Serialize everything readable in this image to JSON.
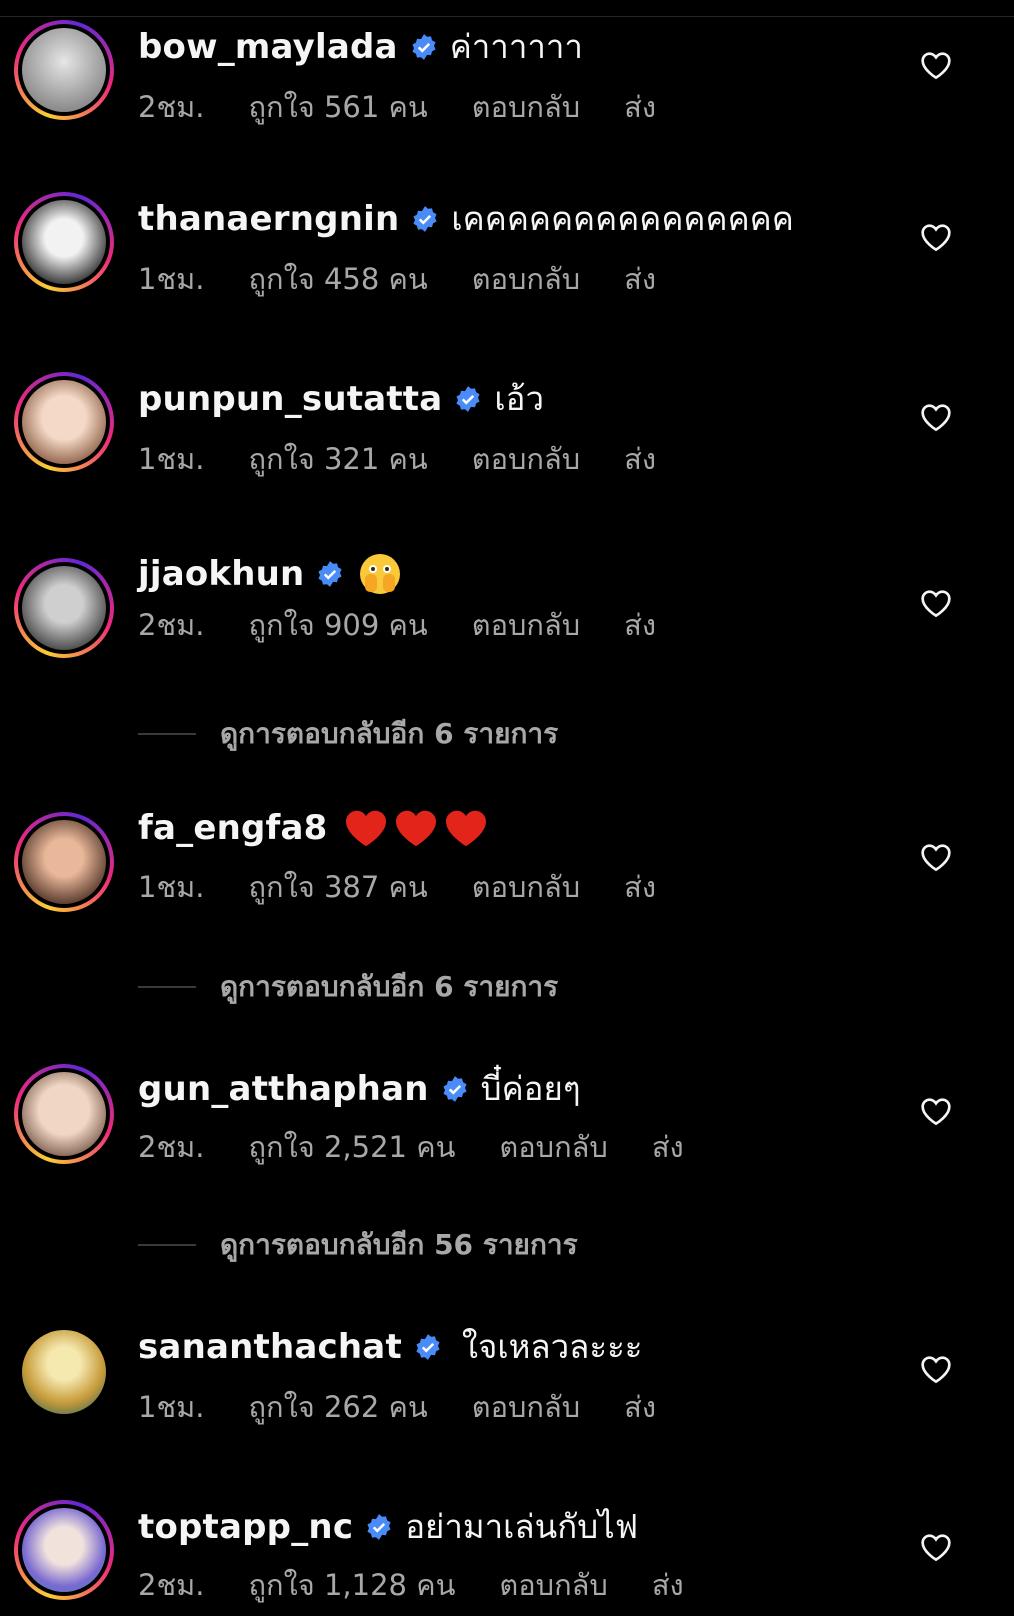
{
  "comments": [
    {
      "username": "bow_maylada",
      "text": "ค่าาาาาา",
      "time": "2ชม.",
      "likes": "ถูกใจ 561 คน",
      "reply": "ตอบกลับ",
      "send": "ส่ง",
      "avatar_color": "#cfcfcf"
    },
    {
      "username": "thanaerngnin",
      "text": "เคคคคคคคคคคคคคคค",
      "time": "1ชม.",
      "likes": "ถูกใจ 458 คน",
      "reply": "ตอบกลับ",
      "send": "ส่ง",
      "avatar_color": "#e8e8e8"
    },
    {
      "username": "punpun_sutatta",
      "text": "เอ้ว",
      "time": "1ชม.",
      "likes": "ถูกใจ 321 คน",
      "reply": "ตอบกลับ",
      "send": "ส่ง",
      "avatar_color": "#d9b49b"
    },
    {
      "username": "jjaokhun",
      "text": "",
      "emoji": "face-with-open-eyes-and-hand-over-mouth",
      "time": "2ชม.",
      "likes": "ถูกใจ 909 คน",
      "reply": "ตอบกลับ",
      "send": "ส่ง",
      "avatar_color": "#9a9a9a"
    },
    {
      "username": "fa_engfa8",
      "text": "",
      "emoji": "red-heart-x3",
      "time": "1ชม.",
      "likes": "ถูกใจ 387 คน",
      "reply": "ตอบกลับ",
      "send": "ส่ง",
      "avatar_color": "#c98a6e"
    },
    {
      "username": "gun_atthaphan",
      "text": "บี๋ค่อยๆ",
      "time": "2ชม.",
      "likes": "ถูกใจ 2,521 คน",
      "reply": "ตอบกลับ",
      "send": "ส่ง",
      "avatar_color": "#e2c6b2"
    },
    {
      "username": "sananthachat",
      "text": "ใจเหลวละะะ",
      "time": "1ชม.",
      "likes": "ถูกใจ 262 คน",
      "reply": "ตอบกลับ",
      "send": "ส่ง",
      "avatar_color": "#e9d27a"
    },
    {
      "username": "toptapp_nc",
      "text": "อย่ามาเล่นกับไฟ",
      "time": "2ชม.",
      "likes": "ถูกใจ 1,128 คน",
      "reply": "ตอบกลับ",
      "send": "ส่ง",
      "avatar_color": "#7ab7d9"
    }
  ],
  "view_replies": [
    {
      "label": "ดูการตอบกลับอีก 6 รายการ"
    },
    {
      "label": "ดูการตอบกลับอีก 6 รายการ"
    },
    {
      "label": "ดูการตอบกลับอีก 56 รายการ"
    }
  ],
  "colors": {
    "background": "#000000",
    "text": "#f5f5f5",
    "secondary": "#a8a8a8",
    "verified": "#4a8cf7",
    "heart": "#e2241a"
  },
  "icons": {
    "verified": "verified-badge-icon",
    "like": "heart-outline-icon"
  }
}
